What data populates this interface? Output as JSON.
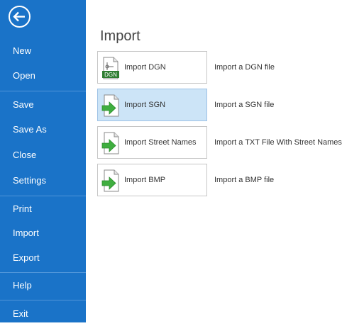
{
  "sidebar": {
    "items": [
      {
        "label": "New"
      },
      {
        "label": "Open"
      },
      {
        "label": "Save"
      },
      {
        "label": "Save As"
      },
      {
        "label": "Close"
      },
      {
        "label": "Settings"
      },
      {
        "label": "Print"
      },
      {
        "label": "Import"
      },
      {
        "label": "Export"
      },
      {
        "label": "Help"
      },
      {
        "label": "Exit"
      }
    ]
  },
  "main": {
    "title": "Import",
    "commands": [
      {
        "label": "Import DGN",
        "description": "Import a DGN file",
        "icon": "dgn-file-icon",
        "icon_badge": "DGN",
        "selected": false
      },
      {
        "label": "Import SGN",
        "description": "Import a SGN file",
        "icon": "import-arrow-file-icon",
        "selected": true
      },
      {
        "label": "Import Street Names",
        "description": "Import a TXT File With Street Names",
        "icon": "import-arrow-file-icon",
        "selected": false
      },
      {
        "label": "Import BMP",
        "description": "Import a BMP file",
        "icon": "import-arrow-file-icon",
        "selected": false
      }
    ]
  },
  "colors": {
    "sidebar_bg": "#1a73c8",
    "selected_bg": "#cce4f7",
    "arrow_green": "#3fae3f"
  }
}
